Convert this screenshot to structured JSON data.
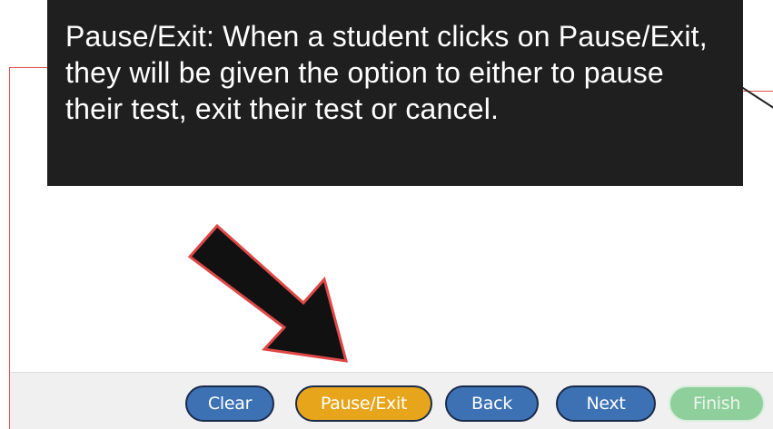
{
  "callout": {
    "title": "Pause/Exit:",
    "body": " When a student clicks on Pause/Exit, they will be given the option to either to pause their test, exit their test or cancel."
  },
  "toolbar": {
    "clear_label": "Clear",
    "pause_exit_label": "Pause/Exit",
    "back_label": "Back",
    "next_label": "Next",
    "finish_label": "Finish"
  },
  "colors": {
    "frame_red": "#e0504f",
    "button_blue": "#3c72b4",
    "button_yellow": "#e6a51a",
    "button_finish_disabled": "#8fcf9c",
    "callout_bg": "#1f1f1f"
  }
}
